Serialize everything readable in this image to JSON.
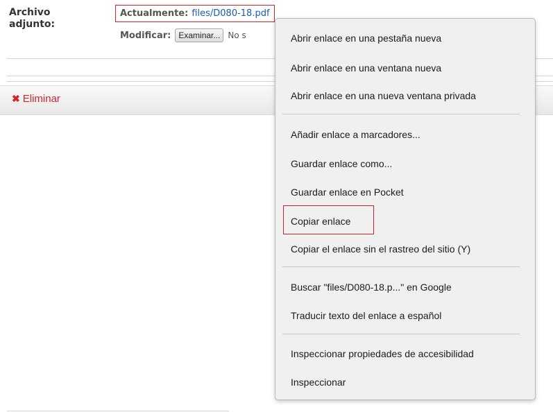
{
  "form": {
    "attachment_label": "Archivo adjunto:",
    "current_label": "Actualmente:",
    "current_file": "files/D080-18.pdf",
    "modify_label": "Modificar:",
    "browse_button": "Examinar...",
    "no_file_text": "No s"
  },
  "delete_action": {
    "icon": "x-icon",
    "icon_glyph": "✖",
    "label": "Eliminar",
    "color": "#d0262a"
  },
  "context_menu": {
    "items": [
      "Abrir enlace en una pestaña nueva",
      "Abrir enlace en una ventana nueva",
      "Abrir enlace en una nueva ventana privada",
      "Añadir enlace a marcadores...",
      "Guardar enlace como...",
      "Guardar enlace en Pocket",
      "Copiar enlace",
      "Copiar el enlace sin el rastreo del sitio (Y)",
      "Buscar \"files/D080-18.p...\" en Google",
      "Traducir texto del enlace a español",
      "Inspeccionar propiedades de accesibilidad",
      "Inspeccionar"
    ],
    "highlighted_item": "Copiar enlace"
  },
  "colors": {
    "highlight_border": "#d0222b",
    "link": "#1a5bb3",
    "menu_background": "#f0f0f0"
  }
}
